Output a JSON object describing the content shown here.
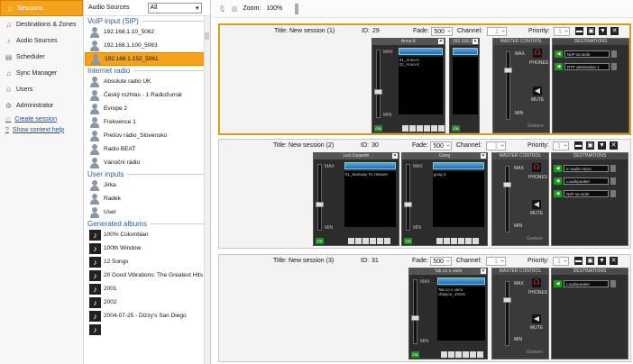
{
  "nav": {
    "items": [
      {
        "label": "Sessions",
        "icon": "music-icon",
        "selected": true
      },
      {
        "label": "Destinations & Zones",
        "icon": "music-icon"
      },
      {
        "label": "Audio Sources",
        "icon": "microphone-icon"
      },
      {
        "label": "Scheduler",
        "icon": "calendar-icon"
      },
      {
        "label": "Sync Manager",
        "icon": "music-icon"
      },
      {
        "label": "Users",
        "icon": "users-icon"
      },
      {
        "label": "Administrator",
        "icon": "gear-icon"
      }
    ],
    "links": [
      {
        "label": "Create session",
        "icon": "star-icon"
      },
      {
        "label": "Show context help",
        "icon": "question-icon"
      }
    ]
  },
  "sources": {
    "header_label": "Audio Sources",
    "filter": "All",
    "categories": [
      {
        "label": "VoIP input (SIP)",
        "items": [
          {
            "label": "192.168.1.10_5062",
            "type": "person"
          },
          {
            "label": "192.168.1.100_5063",
            "type": "person"
          },
          {
            "label": "192.168.1.152_5061",
            "type": "person",
            "selected": true
          }
        ]
      },
      {
        "label": "Internet radio",
        "items": [
          {
            "label": "Absolute radio UK",
            "type": "person"
          },
          {
            "label": "Český rozhlas - 1 Radiožurnál",
            "type": "person"
          },
          {
            "label": "Evrope 2",
            "type": "person"
          },
          {
            "label": "Frekvence 1",
            "type": "person"
          },
          {
            "label": "Prešov rádio_Slovensko",
            "type": "person"
          },
          {
            "label": "Radio BEAT",
            "type": "person"
          },
          {
            "label": "Vánoční rádio",
            "type": "person"
          }
        ]
      },
      {
        "label": "User inputs",
        "items": [
          {
            "label": "Jirka",
            "type": "person"
          },
          {
            "label": "Radek",
            "type": "person"
          },
          {
            "label": "User",
            "type": "person"
          }
        ]
      },
      {
        "label": "Generated albums",
        "items": [
          {
            "label": "100% Colombian",
            "type": "album"
          },
          {
            "label": "100th Window",
            "type": "album"
          },
          {
            "label": "12 Songs",
            "type": "album"
          },
          {
            "label": "20 Good Vibrations: The Greatest Hits",
            "type": "album"
          },
          {
            "label": "2001",
            "type": "album"
          },
          {
            "label": "2002",
            "type": "album"
          },
          {
            "label": "2004-07-25 - Dizzy's San Diego",
            "type": "album"
          },
          {
            "label": "",
            "type": "album"
          }
        ]
      }
    ]
  },
  "toolbar": {
    "zoom_label": "Zoom:",
    "zoom_value": "100%"
  },
  "labels": {
    "title": "Title:",
    "id": "ID:",
    "fade": "Fade:",
    "channel": "Channel:",
    "priority": "Priority:",
    "master_control": "MASTER CONTROL",
    "destinations": "DESTINATIONS",
    "phones": "PHONES",
    "mute": "MUTE",
    "max": "MAX",
    "min": "MIN",
    "on": "ON",
    "gesture": "Gesture"
  },
  "sessions": [
    {
      "title": "New session (1)",
      "id": "29",
      "fade": "500",
      "channel": "1",
      "priority": "1",
      "active": true,
      "strips": [
        {
          "title": "Anna K",
          "playlist": [
            "01_Anna K",
            "02_Anna K"
          ]
        },
        {
          "title": "192.168.1.1",
          "playlist": []
        }
      ],
      "destinations": [
        "NxP na stole",
        "RTP destination 1"
      ]
    },
    {
      "title": "New session (2)",
      "id": "30",
      "fade": "500",
      "channel": "1",
      "priority": "1",
      "strips": [
        {
          "title": "Led Zeppelin",
          "playlist": [
            "01_Stairway To Heaven"
          ]
        },
        {
          "title": "Gong",
          "playlist": [
            "gong 3"
          ]
        }
      ],
      "destinations": [
        "Ic-audio repro",
        "Loudspeaker",
        "NxP na stole"
      ]
    },
    {
      "title": "New session (3)",
      "id": "31",
      "fade": "500",
      "channel": "1",
      "priority": "1",
      "strips": [
        {
          "title": "Tak co s vámi",
          "playlist": [
            "Tak co s vámi chlapce_10zes"
          ]
        }
      ],
      "destinations": [
        "Loudspeaker"
      ]
    }
  ]
}
